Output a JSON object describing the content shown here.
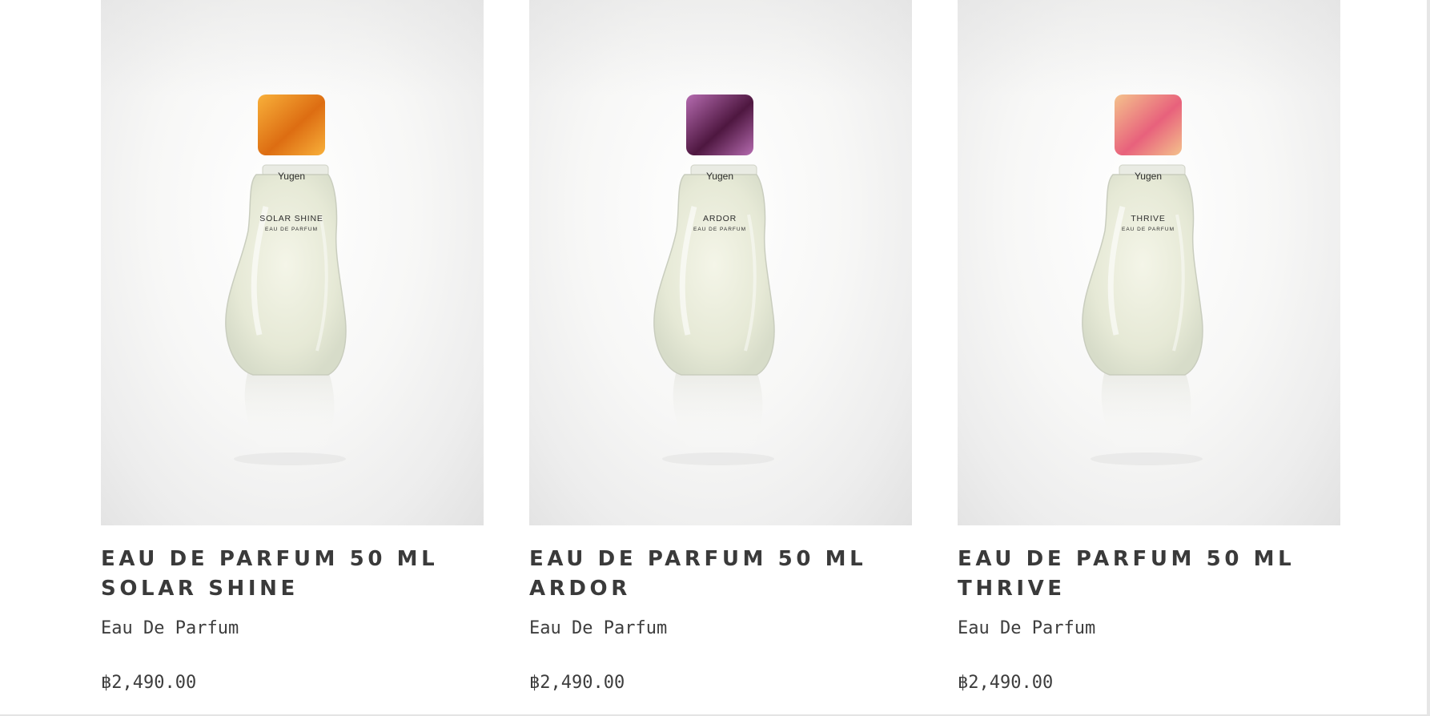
{
  "products": [
    {
      "title_line1": "EAU DE PARFUM 50 ML",
      "title_line2": "SOLAR SHINE",
      "subtitle": "Eau De Parfum",
      "price": "฿2,490.00",
      "bottle": {
        "brand": "Yugen",
        "name": "SOLAR SHINE",
        "type": "EAU DE PARFUM",
        "cap_color_light": "#f8b03a",
        "cap_color_dark": "#dd6d12"
      }
    },
    {
      "title_line1": "EAU DE PARFUM 50 ML",
      "title_line2": "ARDOR",
      "subtitle": "Eau De Parfum",
      "price": "฿2,490.00",
      "bottle": {
        "brand": "Yugen",
        "name": "ARDOR",
        "type": "EAU DE PARFUM",
        "cap_color_light": "#b56bb0",
        "cap_color_dark": "#4e1740"
      }
    },
    {
      "title_line1": "EAU DE PARFUM 50 ML",
      "title_line2": "THRIVE",
      "subtitle": "Eau De Parfum",
      "price": "฿2,490.00",
      "bottle": {
        "brand": "Yugen",
        "name": "THRIVE",
        "type": "EAU DE PARFUM",
        "cap_color_light": "#f4c28c",
        "cap_color_dark": "#e8617c"
      }
    }
  ]
}
